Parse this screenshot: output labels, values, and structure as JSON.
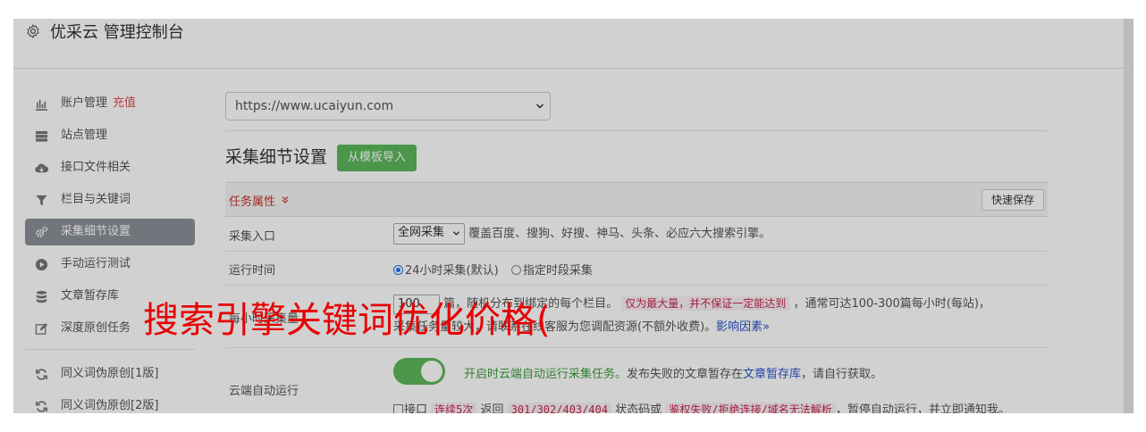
{
  "header": {
    "title": "优采云 管理控制台",
    "icon": "gear-icon"
  },
  "sidebar": {
    "items": [
      {
        "label": "账户管理",
        "badge": "充值",
        "icon": "bar-chart-icon"
      },
      {
        "label": "站点管理",
        "icon": "server-icon"
      },
      {
        "label": "接口文件相关",
        "icon": "cloud-download-icon"
      },
      {
        "label": "栏目与关键词",
        "icon": "filter-icon"
      },
      {
        "label": "采集细节设置",
        "icon": "cogs-icon",
        "active": true
      },
      {
        "label": "手动运行测试",
        "icon": "play-circle-icon"
      },
      {
        "label": "文章暂存库",
        "icon": "database-icon"
      },
      {
        "label": "深度原创任务",
        "icon": "edit-icon"
      }
    ],
    "tool_items": [
      {
        "label": "同义词伪原创[1版]",
        "icon": "refresh-icon"
      },
      {
        "label": "同义词伪原创[2版]",
        "icon": "refresh-icon"
      }
    ]
  },
  "main": {
    "site_select": "https://www.ucaiyun.com",
    "section_title": "采集细节设置",
    "template_button": "从模板导入",
    "task_bar": {
      "label": "任务属性",
      "save_button": "快速保存"
    },
    "rows": {
      "entry": {
        "label": "采集入口",
        "select_value": "全网采集",
        "desc": "覆盖百度、搜狗、好搜、神马、头条、必应六大搜索引擎。"
      },
      "time": {
        "label": "运行时间",
        "option1": "24小时采集(默认)",
        "option2": "指定时段采集"
      },
      "count": {
        "label": "每小时采集量",
        "value": "100",
        "text1": "篇，随机分布到绑定的每个栏目。",
        "tag": "仅为最大量，并不保证一定能达到",
        "text2": "，通常可达100-300篇每小时(每站)，",
        "line2": "采集任务量较大，请联系在线客服为您调配资源(不额外收费)。",
        "link": "影响因素"
      },
      "cloud": {
        "label": "云端自动运行",
        "toggle_on": true,
        "text_green": "开启时云端自动运行采集任务。",
        "text_mid": "发布失败的文章暂存在",
        "link": "文章暂存库",
        "text_end": "，请自行获取。",
        "cb_label": "接口",
        "tag1": "连续5次",
        "text_a": "返回",
        "tag2": "301/302/403/404",
        "text_b": "状态码或",
        "tag3": "鉴权失败/拒绝连接/域名无法解析",
        "text_c": "，暂停自动运行，并立即通知我。"
      }
    }
  },
  "watermark": "搜索引擎关键词优化价格(",
  "colors": {
    "accent_green": "#5cb85c",
    "active_item": "#8b8f97",
    "watermark": "#e80000",
    "link": "#2a54c9"
  }
}
